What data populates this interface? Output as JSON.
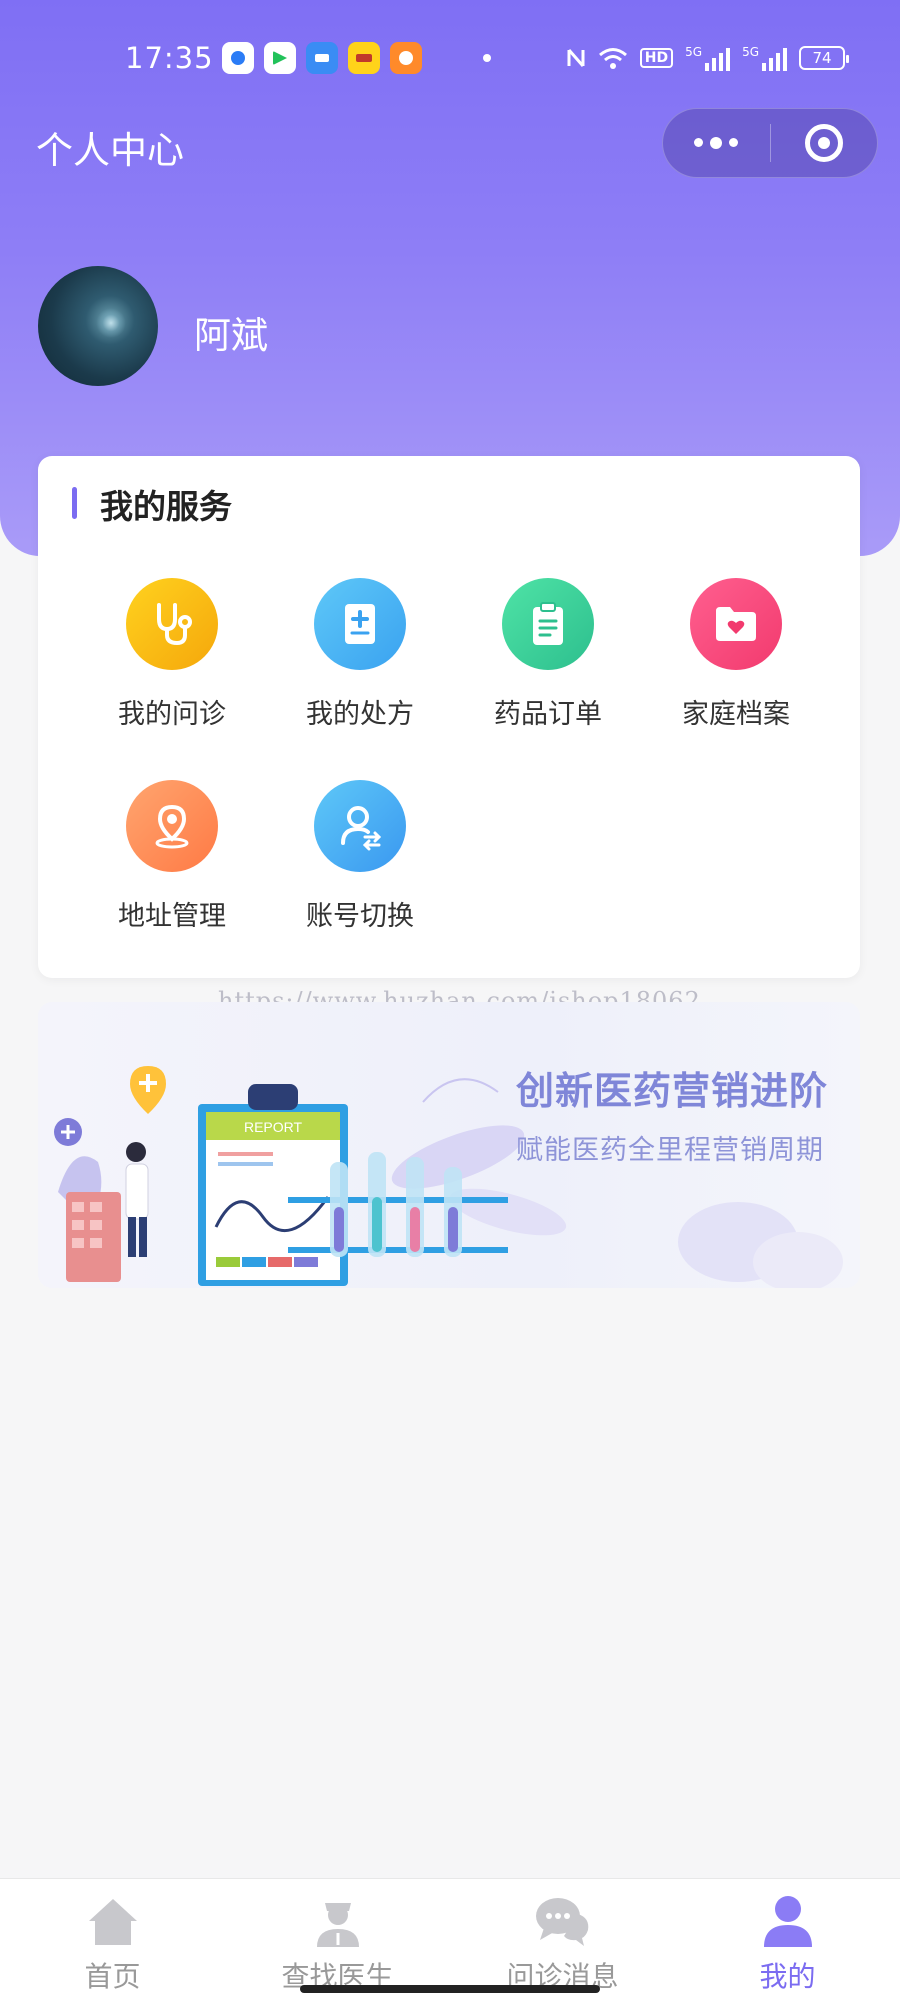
{
  "status_bar": {
    "time": "17:35",
    "battery": "74",
    "hd_label": "HD",
    "network_1": "5G",
    "network_2": "5G"
  },
  "header": {
    "title": "个人中心"
  },
  "user": {
    "name": "阿斌"
  },
  "services": {
    "title": "我的服务",
    "items": [
      {
        "label": "我的问诊",
        "icon": "stethoscope-icon",
        "color_from": "#ffd21f",
        "color_to": "#f5a70b"
      },
      {
        "label": "我的处方",
        "icon": "prescription-icon",
        "color_from": "#5ec8f8",
        "color_to": "#3aa2f0"
      },
      {
        "label": "药品订单",
        "icon": "clipboard-icon",
        "color_from": "#4fe3a6",
        "color_to": "#2dbf8e"
      },
      {
        "label": "家庭档案",
        "icon": "folder-heart-icon",
        "color_from": "#ff5f8f",
        "color_to": "#f23a6e"
      },
      {
        "label": "地址管理",
        "icon": "location-pin-icon",
        "color_from": "#ffa56f",
        "color_to": "#ff7a45"
      },
      {
        "label": "账号切换",
        "icon": "account-switch-icon",
        "color_from": "#5ec8f8",
        "color_to": "#3a98f0"
      }
    ]
  },
  "watermark": "https://www.huzhan.com/ishop18062",
  "banner": {
    "title": "创新医药营销进阶",
    "subtitle": "赋能医药全里程营销周期",
    "report_label": "REPORT"
  },
  "tabbar": {
    "items": [
      {
        "label": "首页",
        "icon": "home-icon",
        "active": false
      },
      {
        "label": "查找医生",
        "icon": "doctor-icon",
        "active": false
      },
      {
        "label": "问诊消息",
        "icon": "chat-icon",
        "active": false
      },
      {
        "label": "我的",
        "icon": "profile-icon",
        "active": true
      }
    ]
  },
  "colors": {
    "accent": "#7b6cf1",
    "header_top": "#7f6ff4",
    "header_bottom": "#a99bf8"
  }
}
